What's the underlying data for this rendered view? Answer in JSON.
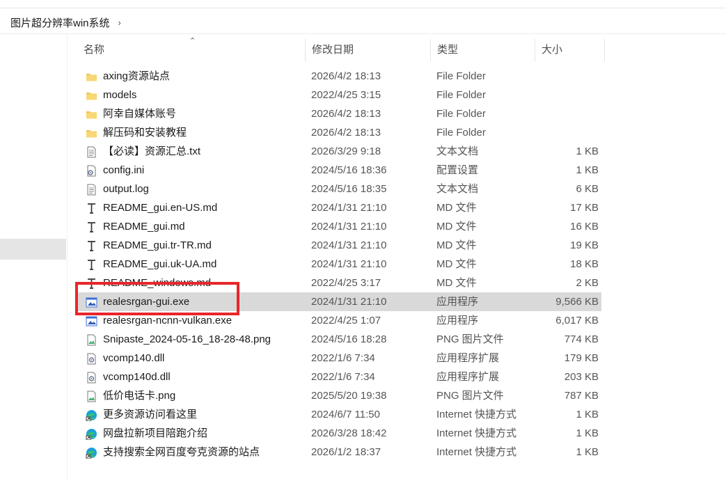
{
  "breadcrumb": {
    "folder": "图片超分辨率win系统",
    "chevron": "›"
  },
  "columns": {
    "name": "名称",
    "date": "修改日期",
    "type": "类型",
    "size": "大小"
  },
  "files": [
    {
      "icon": "folder-icon",
      "name": "axing资源站点",
      "date": "2026/4/2 18:13",
      "type": "File Folder",
      "size": ""
    },
    {
      "icon": "folder-icon",
      "name": "models",
      "date": "2022/4/25 3:15",
      "type": "File Folder",
      "size": ""
    },
    {
      "icon": "folder-icon",
      "name": "阿幸自媒体账号",
      "date": "2026/4/2 18:13",
      "type": "File Folder",
      "size": ""
    },
    {
      "icon": "folder-icon",
      "name": "解压码和安装教程",
      "date": "2026/4/2 18:13",
      "type": "File Folder",
      "size": ""
    },
    {
      "icon": "text-file-icon",
      "name": "【必读】资源汇总.txt",
      "date": "2026/3/29 9:18",
      "type": "文本文档",
      "size": "1 KB"
    },
    {
      "icon": "settings-file-icon",
      "name": "config.ini",
      "date": "2024/5/16 18:36",
      "type": "配置设置",
      "size": "1 KB"
    },
    {
      "icon": "text-file-icon",
      "name": "output.log",
      "date": "2024/5/16 18:35",
      "type": "文本文档",
      "size": "6 KB"
    },
    {
      "icon": "markdown-file-icon",
      "name": "README_gui.en-US.md",
      "date": "2024/1/31 21:10",
      "type": "MD 文件",
      "size": "17 KB"
    },
    {
      "icon": "markdown-file-icon",
      "name": "README_gui.md",
      "date": "2024/1/31 21:10",
      "type": "MD 文件",
      "size": "16 KB"
    },
    {
      "icon": "markdown-file-icon",
      "name": "README_gui.tr-TR.md",
      "date": "2024/1/31 21:10",
      "type": "MD 文件",
      "size": "19 KB"
    },
    {
      "icon": "markdown-file-icon",
      "name": "README_gui.uk-UA.md",
      "date": "2024/1/31 21:10",
      "type": "MD 文件",
      "size": "18 KB"
    },
    {
      "icon": "markdown-file-icon",
      "name": "README_windows.md",
      "date": "2022/4/25 3:17",
      "type": "MD 文件",
      "size": "2 KB"
    },
    {
      "icon": "application-icon",
      "name": "realesrgan-gui.exe",
      "date": "2024/1/31 21:10",
      "type": "应用程序",
      "size": "9,566 KB"
    },
    {
      "icon": "application-icon",
      "name": "realesrgan-ncnn-vulkan.exe",
      "date": "2022/4/25 1:07",
      "type": "应用程序",
      "size": "6,017 KB"
    },
    {
      "icon": "image-file-icon",
      "name": "Snipaste_2024-05-16_18-28-48.png",
      "date": "2024/5/16 18:28",
      "type": "PNG 图片文件",
      "size": "774 KB"
    },
    {
      "icon": "dll-file-icon",
      "name": "vcomp140.dll",
      "date": "2022/1/6 7:34",
      "type": "应用程序扩展",
      "size": "179 KB"
    },
    {
      "icon": "dll-file-icon",
      "name": "vcomp140d.dll",
      "date": "2022/1/6 7:34",
      "type": "应用程序扩展",
      "size": "203 KB"
    },
    {
      "icon": "image-file-icon",
      "name": "低价电话卡.png",
      "date": "2025/5/20 19:38",
      "type": "PNG 图片文件",
      "size": "787 KB"
    },
    {
      "icon": "edge-shortcut-icon",
      "name": "更多资源访问看这里",
      "date": "2024/6/7 11:50",
      "type": "Internet 快捷方式",
      "size": "1 KB"
    },
    {
      "icon": "edge-shortcut-icon",
      "name": "网盘拉新项目陪跑介绍",
      "date": "2026/3/28 18:42",
      "type": "Internet 快捷方式",
      "size": "1 KB"
    },
    {
      "icon": "edge-shortcut-icon",
      "name": "支持搜索全网百度夸克资源的站点",
      "date": "2026/1/2 18:37",
      "type": "Internet 快捷方式",
      "size": "1 KB"
    }
  ],
  "selected_index": 12,
  "colors": {
    "highlight": "#e8262b",
    "selection": "#d9d9d9",
    "folder": "#f2c14e"
  }
}
